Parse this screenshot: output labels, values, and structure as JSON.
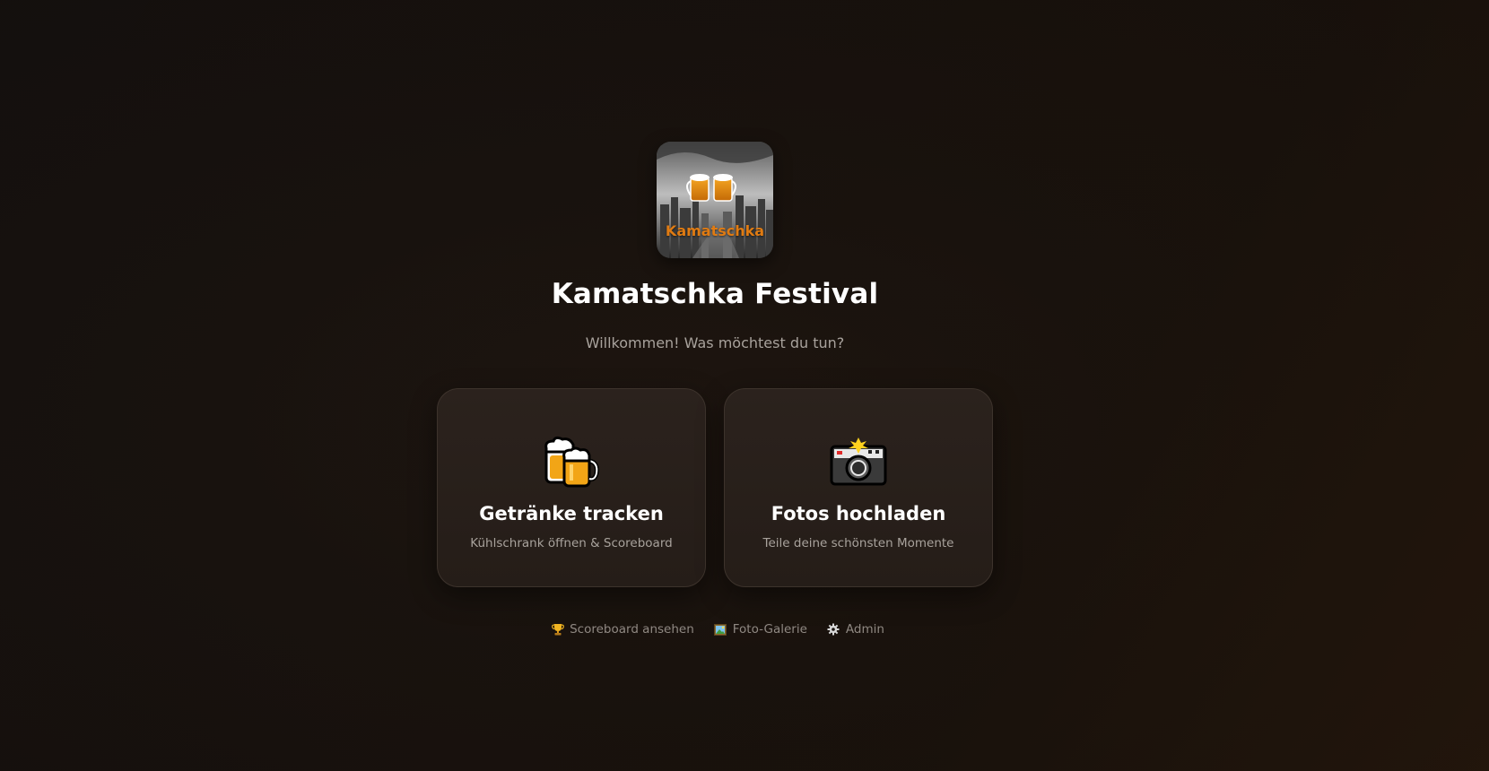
{
  "app": {
    "logo_text": "Kamatschka",
    "title": "Kamatschka Festival",
    "subtitle": "Willkommen! Was möchtest du tun?"
  },
  "cards": [
    {
      "icon": "beer-mugs-icon",
      "title": "Getränke tracken",
      "description": "Kühlschrank öffnen & Scoreboard"
    },
    {
      "icon": "camera-flash-icon",
      "title": "Fotos hochladen",
      "description": "Teile deine schönsten Momente"
    }
  ],
  "footer": {
    "links": [
      {
        "icon": "trophy-icon",
        "label": "Scoreboard ansehen"
      },
      {
        "icon": "picture-icon",
        "label": "Foto-Galerie"
      },
      {
        "icon": "gear-icon",
        "label": "Admin"
      }
    ]
  },
  "colors": {
    "accent_orange": "#e07b12",
    "text_muted": "#a8a29c",
    "card_bg": "#2b221d"
  }
}
